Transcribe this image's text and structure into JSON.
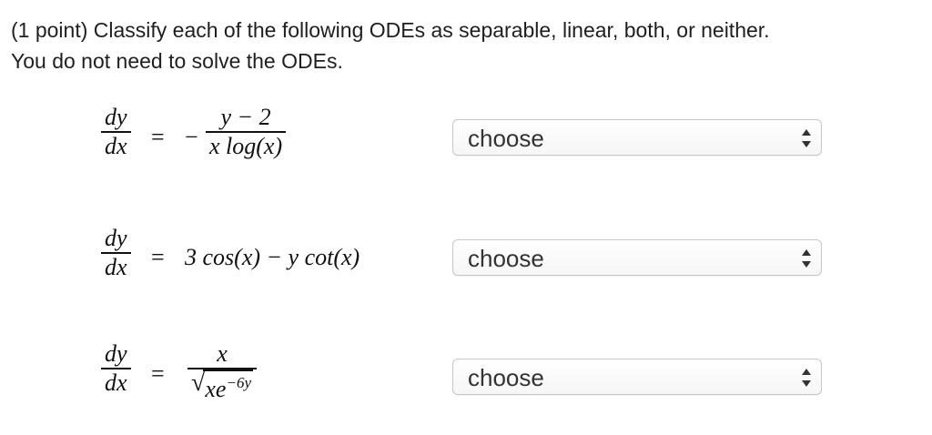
{
  "prompt": {
    "line1": "(1 point) Classify each of the following ODEs as separable, linear, both, or neither.",
    "line2": "You do not need to solve the ODEs."
  },
  "equations": [
    {
      "lhs_num": "dy",
      "lhs_den": "dx",
      "equals": "=",
      "minus": "−",
      "rhs_num": "y − 2",
      "rhs_den": "x log(x)",
      "select_value": "choose"
    },
    {
      "lhs_num": "dy",
      "lhs_den": "dx",
      "equals": "=",
      "rhs": "3 cos(x) − y cot(x)",
      "select_value": "choose"
    },
    {
      "lhs_num": "dy",
      "lhs_den": "dx",
      "equals": "=",
      "rhs_num": "x",
      "rhs_den_radical": "√",
      "rhs_den_base": "xe",
      "rhs_den_exp": "−6y",
      "select_value": "choose"
    }
  ],
  "icons": {
    "select_arrows": "up-down-arrows-icon"
  }
}
